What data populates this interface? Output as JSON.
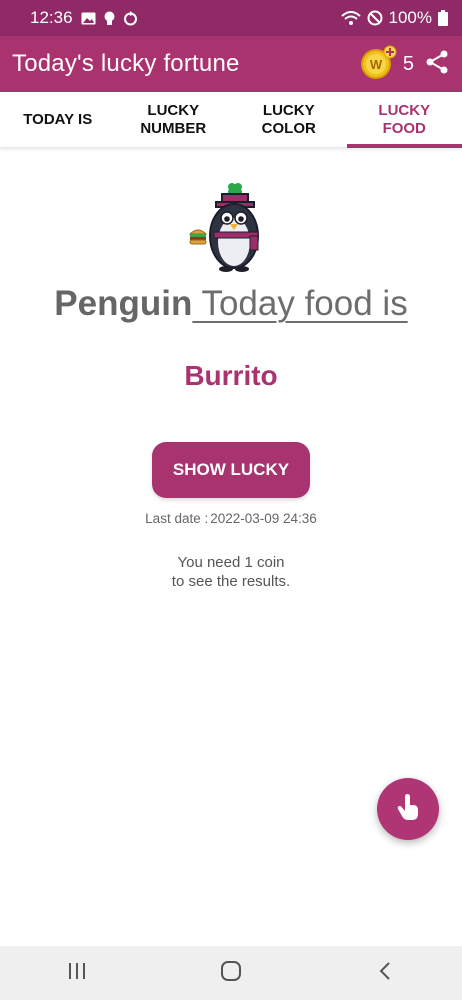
{
  "status_bar": {
    "time": "12:36",
    "battery": "100%",
    "icons": [
      "image-icon",
      "lightbulb-icon",
      "sync-icon",
      "wifi-icon",
      "do-not-disturb-icon",
      "battery-icon"
    ]
  },
  "app_bar": {
    "title": "Today's lucky fortune",
    "coin_count": "5",
    "coin_symbol": "W",
    "share_icon": "share-icon"
  },
  "tabs": [
    {
      "label": "TODAY IS",
      "active": false
    },
    {
      "label": "LUCKY\nNUMBER",
      "active": false
    },
    {
      "label": "LUCKY\nCOLOR",
      "active": false
    },
    {
      "label": "LUCKY\nFOOD",
      "active": true
    }
  ],
  "content": {
    "mascot_name": "Penguin",
    "headline_phrase": " Today food is",
    "food_result": "Burrito",
    "show_button_label": "SHOW LUCKY",
    "last_date_label": "Last date :",
    "last_date_value": "2022-03-09 24:36",
    "coin_note_line1": "You need 1 coin",
    "coin_note_line2": "to see the results."
  },
  "colors": {
    "status_bar": "#8f2a66",
    "primary": "#a9336f",
    "fab": "#b03574",
    "nav_bar": "#efefef"
  },
  "fab": {
    "icon": "tap-hand-icon"
  },
  "nav_bar": {
    "icons": [
      "recent-apps-icon",
      "home-icon",
      "back-icon"
    ]
  }
}
